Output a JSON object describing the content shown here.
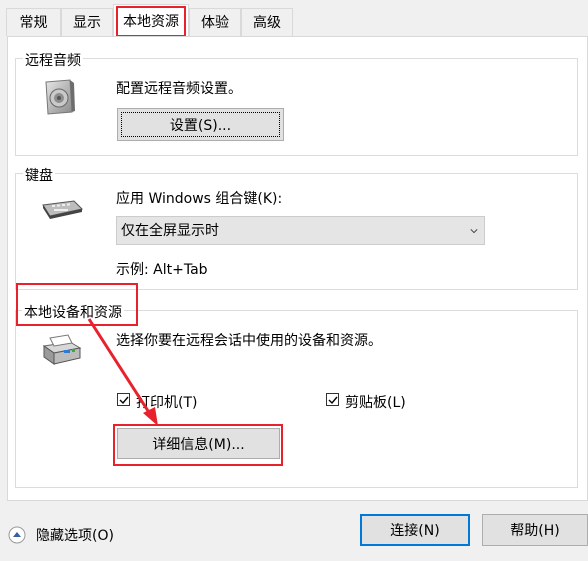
{
  "tabs": [
    {
      "label": "常规"
    },
    {
      "label": "显示"
    },
    {
      "label": "本地资源",
      "active": true
    },
    {
      "label": "体验"
    },
    {
      "label": "高级"
    }
  ],
  "remote_audio": {
    "title": "远程音频",
    "description": "配置远程音频设置。",
    "settings_button": "设置(S)..."
  },
  "keyboard": {
    "title": "键盘",
    "apply_label": "应用 Windows 组合键(K):",
    "selected_option": "仅在全屏显示时",
    "example": "示例: Alt+Tab"
  },
  "local_devices": {
    "title": "本地设备和资源",
    "description": "选择你要在远程会话中使用的设备和资源。",
    "printers_label": "打印机(T)",
    "printers_checked": true,
    "clipboard_label": "剪贴板(L)",
    "clipboard_checked": true,
    "more_button": "详细信息(M)..."
  },
  "footer": {
    "hide_options": "隐藏选项(O)",
    "connect_button": "连接(N)",
    "help_button": "帮助(H)"
  },
  "colors": {
    "highlight": "#e8222c",
    "focus": "#0078d7"
  }
}
